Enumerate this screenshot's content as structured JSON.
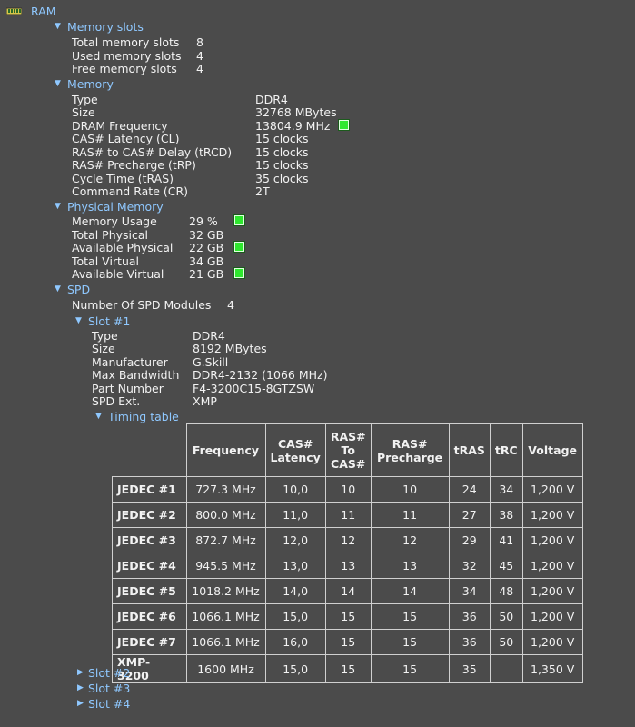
{
  "ram": {
    "label": "RAM"
  },
  "memory_slots": {
    "title": "Memory slots",
    "rows": [
      {
        "label": "Total memory slots",
        "value": "8"
      },
      {
        "label": "Used memory slots",
        "value": "4"
      },
      {
        "label": "Free memory slots",
        "value": "4"
      }
    ]
  },
  "memory": {
    "title": "Memory",
    "rows": [
      {
        "label": "Type",
        "value": "DDR4"
      },
      {
        "label": "Size",
        "value": "32768 MBytes"
      },
      {
        "label": "DRAM Frequency",
        "value": "13804.9 MHz"
      },
      {
        "label": "CAS# Latency (CL)",
        "value": "15 clocks"
      },
      {
        "label": "RAS# to CAS# Delay (tRCD)",
        "value": "15 clocks"
      },
      {
        "label": "RAS# Precharge (tRP)",
        "value": "15 clocks"
      },
      {
        "label": "Cycle Time (tRAS)",
        "value": "35 clocks"
      },
      {
        "label": "Command Rate (CR)",
        "value": "2T"
      }
    ]
  },
  "physical_memory": {
    "title": "Physical Memory",
    "rows": [
      {
        "label": "Memory Usage",
        "value": "29 %"
      },
      {
        "label": "Total Physical",
        "value": "32 GB"
      },
      {
        "label": "Available Physical",
        "value": "22 GB"
      },
      {
        "label": "Total Virtual",
        "value": "34 GB"
      },
      {
        "label": "Available Virtual",
        "value": "21 GB"
      }
    ]
  },
  "spd": {
    "title": "SPD",
    "modules_label": "Number Of SPD Modules",
    "modules_value": "4",
    "slot1": {
      "title": "Slot #1",
      "rows": [
        {
          "label": "Type",
          "value": "DDR4"
        },
        {
          "label": "Size",
          "value": "8192 MBytes"
        },
        {
          "label": "Manufacturer",
          "value": "G.Skill"
        },
        {
          "label": "Max Bandwidth",
          "value": "DDR4-2132 (1066 MHz)"
        },
        {
          "label": "Part Number",
          "value": "F4-3200C15-8GTZSW"
        },
        {
          "label": "SPD Ext.",
          "value": "XMP"
        }
      ],
      "timing_title": "Timing table",
      "timing": {
        "headers": [
          "Frequency",
          "CAS# Latency",
          "RAS# To CAS#",
          "RAS# Precharge",
          "tRAS",
          "tRC",
          "Voltage"
        ],
        "rows": [
          [
            "JEDEC #1",
            "727.3 MHz",
            "10,0",
            "10",
            "10",
            "24",
            "34",
            "1,200 V"
          ],
          [
            "JEDEC #2",
            "800.0 MHz",
            "11,0",
            "11",
            "11",
            "27",
            "38",
            "1,200 V"
          ],
          [
            "JEDEC #3",
            "872.7 MHz",
            "12,0",
            "12",
            "12",
            "29",
            "41",
            "1,200 V"
          ],
          [
            "JEDEC #4",
            "945.5 MHz",
            "13,0",
            "13",
            "13",
            "32",
            "45",
            "1,200 V"
          ],
          [
            "JEDEC #5",
            "1018.2 MHz",
            "14,0",
            "14",
            "14",
            "34",
            "48",
            "1,200 V"
          ],
          [
            "JEDEC #6",
            "1066.1 MHz",
            "15,0",
            "15",
            "15",
            "36",
            "50",
            "1,200 V"
          ],
          [
            "JEDEC #7",
            "1066.1 MHz",
            "16,0",
            "15",
            "15",
            "36",
            "50",
            "1,200 V"
          ],
          [
            "XMP-3200",
            "1600 MHz",
            "15,0",
            "15",
            "15",
            "35",
            "",
            "1,350 V"
          ]
        ]
      }
    },
    "slot2": {
      "title": "Slot #2"
    },
    "slot3": {
      "title": "Slot #3"
    },
    "slot4": {
      "title": "Slot #4"
    }
  },
  "colors": {
    "background": "#4b4b4b",
    "header": "#8fc8ff",
    "indicator": "#2ee82e",
    "text": "#f2f2f2"
  },
  "icons": [
    "ram-icon",
    "expand-arrow-icon",
    "collapse-arrow-icon",
    "status-indicator-icon"
  ]
}
